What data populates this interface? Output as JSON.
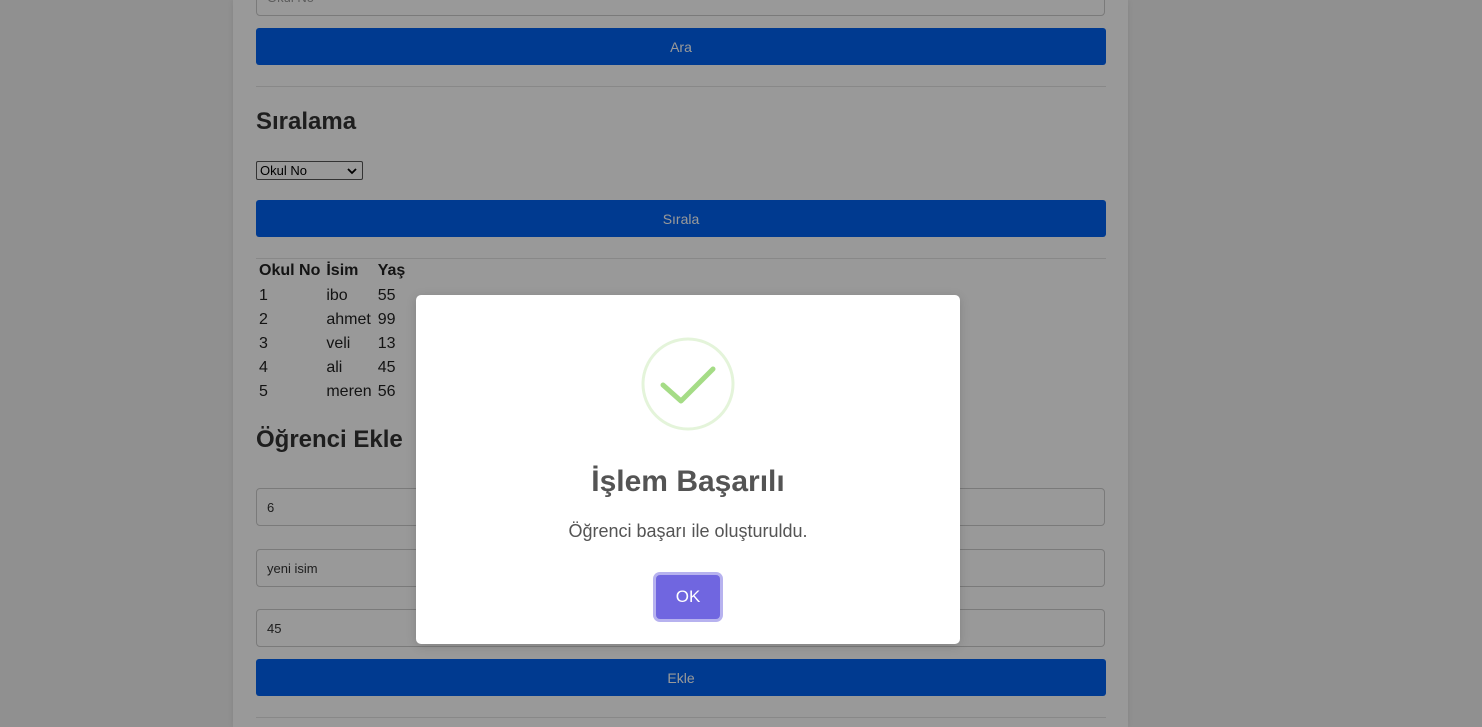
{
  "search": {
    "input_placeholder": "Okul No",
    "button_label": "Ara"
  },
  "sort": {
    "heading": "Sıralama",
    "select_value": "Okul No",
    "button_label": "Sırala"
  },
  "table": {
    "headers": [
      "Okul No",
      "İsim",
      "Yaş"
    ],
    "rows": [
      [
        "1",
        "ibo",
        "55"
      ],
      [
        "2",
        "ahmet",
        "99"
      ],
      [
        "3",
        "veli",
        "13"
      ],
      [
        "4",
        "ali",
        "45"
      ],
      [
        "5",
        "meren",
        "56"
      ]
    ]
  },
  "add_student": {
    "heading": "Öğrenci Ekle",
    "no_value": "6",
    "name_value": "yeni isim",
    "age_value": "45",
    "button_label": "Ekle"
  },
  "dialog": {
    "title": "İşlem Başarılı",
    "message": "Öğrenci başarı ile oluşturuldu.",
    "ok_label": "OK",
    "icon": "success-check-icon"
  },
  "colors": {
    "primary_button": "#0062f0",
    "ok_button": "#7066e0",
    "success_green": "#a5dc86"
  }
}
